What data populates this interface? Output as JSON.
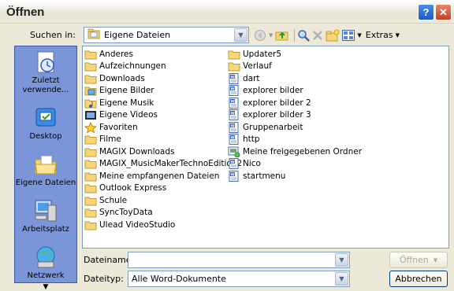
{
  "window": {
    "title": "Öffnen",
    "help_label": "?",
    "close_label": "✕"
  },
  "lookin": {
    "label": "Suchen in:",
    "value": "Eigene Dateien"
  },
  "toolbar": {
    "extras_label": "Extras"
  },
  "places": [
    {
      "label": "Zuletzt verwende...",
      "icon": "recent-icon"
    },
    {
      "label": "Desktop",
      "icon": "desktop-icon"
    },
    {
      "label": "Eigene Dateien",
      "icon": "my-documents-icon"
    },
    {
      "label": "Arbeitsplatz",
      "icon": "my-computer-icon"
    },
    {
      "label": "Netzwerk",
      "icon": "network-icon"
    }
  ],
  "files_col1": [
    {
      "name": "Anderes",
      "icon": "folder"
    },
    {
      "name": "Aufzeichnungen",
      "icon": "folder"
    },
    {
      "name": "Downloads",
      "icon": "folder"
    },
    {
      "name": "Eigene Bilder",
      "icon": "pictures"
    },
    {
      "name": "Eigene Musik",
      "icon": "music"
    },
    {
      "name": "Eigene Videos",
      "icon": "videos"
    },
    {
      "name": "Favoriten",
      "icon": "star"
    },
    {
      "name": "Filme",
      "icon": "folder"
    },
    {
      "name": "MAGIX Downloads",
      "icon": "folder"
    },
    {
      "name": "MAGIX_MusicMakerTechnoEdition2",
      "icon": "folder"
    },
    {
      "name": "Meine empfangenen Dateien",
      "icon": "folder"
    },
    {
      "name": "Outlook Express",
      "icon": "folder"
    },
    {
      "name": "Schule",
      "icon": "folder"
    },
    {
      "name": "SyncToyData",
      "icon": "folder"
    },
    {
      "name": "Ulead VideoStudio",
      "icon": "folder"
    }
  ],
  "files_col2": [
    {
      "name": "Updater5",
      "icon": "folder"
    },
    {
      "name": "Verlauf",
      "icon": "folder"
    },
    {
      "name": "dart",
      "icon": "worddoc"
    },
    {
      "name": "explorer bilder",
      "icon": "worddoc"
    },
    {
      "name": "explorer bilder 2",
      "icon": "worddoc"
    },
    {
      "name": "explorer bilder 3",
      "icon": "worddoc"
    },
    {
      "name": "Gruppenarbeit",
      "icon": "worddoc"
    },
    {
      "name": "http",
      "icon": "worddoc"
    },
    {
      "name": "Meine freigegebenen Ordner",
      "icon": "shared"
    },
    {
      "name": "Nico",
      "icon": "worddoc"
    },
    {
      "name": "startmenu",
      "icon": "worddoc"
    }
  ],
  "filename": {
    "label": "Dateiname:",
    "value": ""
  },
  "filetype": {
    "label": "Dateityp:",
    "value": "Alle Word-Dokumente"
  },
  "buttons": {
    "open": "Öffnen",
    "cancel": "Abbrechen"
  }
}
